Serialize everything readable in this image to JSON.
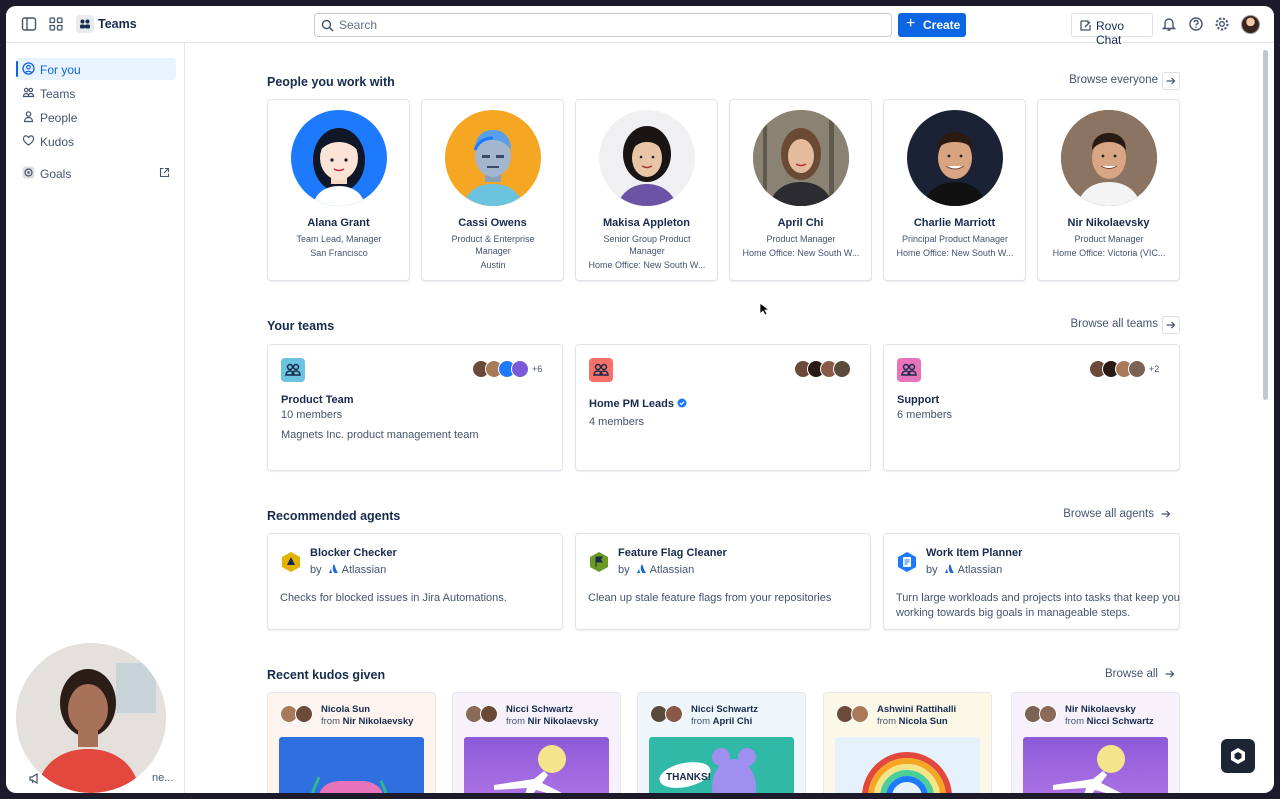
{
  "topbar": {
    "app_title": "Teams",
    "search_placeholder": "Search",
    "create_label": "Create",
    "rovo_label": "Rovo Chat"
  },
  "sidebar": {
    "items": [
      {
        "label": "For you",
        "icon": "user-circle-icon",
        "active": true
      },
      {
        "label": "Teams",
        "icon": "people-group-icon"
      },
      {
        "label": "People",
        "icon": "person-icon"
      },
      {
        "label": "Kudos",
        "icon": "heart-icon"
      },
      {
        "label": "Goals",
        "icon": "goal-icon"
      }
    ],
    "feedback_label": "ne..."
  },
  "people": {
    "title": "People you work with",
    "browse": "Browse everyone",
    "cards": [
      {
        "name": "Alana Grant",
        "lines": [
          "Team Lead, Manager",
          "San Francisco"
        ]
      },
      {
        "name": "Cassi Owens",
        "lines": [
          "Product & Enterprise",
          "Manager",
          "Austin"
        ]
      },
      {
        "name": "Makisa Appleton",
        "lines": [
          "Senior Group Product",
          "Manager",
          "Home Office: New South W..."
        ]
      },
      {
        "name": "April Chi",
        "lines": [
          "Product Manager",
          "Home Office: New South W..."
        ]
      },
      {
        "name": "Charlie Marriott",
        "lines": [
          "Principal Product Manager",
          "Home Office: New South W..."
        ]
      },
      {
        "name": "Nir Nikolaevsky",
        "lines": [
          "Product Manager",
          "Home Office: Victoria (VIC..."
        ]
      }
    ]
  },
  "teams": {
    "title": "Your teams",
    "browse": "Browse all teams",
    "cards": [
      {
        "name": "Product Team",
        "members": "10 members",
        "description": "Magnets Inc. product management team",
        "more": "+6",
        "color": "#6cc3e0"
      },
      {
        "name": "Home PM Leads",
        "members": "4 members",
        "description": "",
        "more": "",
        "verified": true,
        "color": "#f87168"
      },
      {
        "name": "Support",
        "members": "6 members",
        "description": "",
        "more": "+2",
        "color": "#e774bb"
      }
    ]
  },
  "agents": {
    "title": "Recommended agents",
    "browse": "Browse all agents",
    "by_label": "by",
    "publisher": "Atlassian",
    "cards": [
      {
        "name": "Blocker Checker",
        "description": "Checks for blocked issues in Jira Automations.",
        "color": "#e2b203"
      },
      {
        "name": "Feature Flag Cleaner",
        "description": "Clean up stale feature flags from your repositories",
        "color": "#6a9a23"
      },
      {
        "name": "Work Item Planner",
        "description": "Turn large workloads and projects into tasks that keep you working towards big goals in manageable steps.",
        "color": "#1d7afc"
      }
    ]
  },
  "kudos": {
    "title": "Recent kudos given",
    "browse": "Browse all",
    "from_label": "from",
    "cards": [
      {
        "to": "Nicola Sun",
        "from": "Nir Nikolaevsky",
        "bg": "#fdf3ef",
        "art": "#2f6fe0"
      },
      {
        "to": "Nicci Schwartz",
        "from": "Nir Nikolaevsky",
        "bg": "#f7f1fb",
        "art": "#8d5ad8"
      },
      {
        "to": "Nicci Schwartz",
        "from": "April Chi",
        "bg": "#eef5fb",
        "art": "#2fb9a6"
      },
      {
        "to": "Ashwini Rattihalli",
        "from": "Nicola Sun",
        "bg": "#fbf8e8",
        "art": "#e6f2fb"
      },
      {
        "to": "Nir Nikolaevsky",
        "from": "Nicci Schwartz",
        "bg": "#f7f1fb",
        "art": "#8d5ad8"
      }
    ]
  }
}
